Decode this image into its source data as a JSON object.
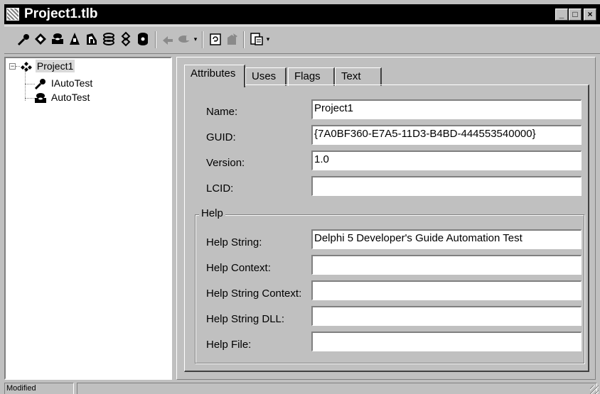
{
  "window": {
    "title": "Project1.tlb",
    "controls": {
      "minimize": "_",
      "maximize": "□",
      "close": "×"
    }
  },
  "toolbar": {
    "buttons": [
      "new-interface-icon",
      "new-dispinterface-icon",
      "new-coclass-icon",
      "new-enum-icon",
      "new-alias-icon",
      "new-record-icon",
      "new-union-icon",
      "new-module-icon",
      "new-method-icon",
      "new-property-icon",
      "refresh-icon",
      "register-icon",
      "export-icon"
    ],
    "dropdown_arrow": "▾"
  },
  "tree": {
    "root": {
      "label": "Project1",
      "expander": "−"
    },
    "children": [
      {
        "label": "IAutoTest",
        "icon": "interface-icon"
      },
      {
        "label": "AutoTest",
        "icon": "coclass-icon"
      }
    ]
  },
  "tabs": [
    "Attributes",
    "Uses",
    "Flags",
    "Text"
  ],
  "attributes": {
    "name_label": "Name:",
    "name_value": "Project1",
    "guid_label": "GUID:",
    "guid_value": "{7A0BF360-E7A5-11D3-B4BD-444553540000}",
    "version_label": "Version:",
    "version_value": "1.0",
    "lcid_label": "LCID:",
    "lcid_value": ""
  },
  "help": {
    "group_title": "Help",
    "help_string_label": "Help String:",
    "help_string_value": "Delphi 5 Developer's Guide Automation Test",
    "help_context_label": "Help Context:",
    "help_context_value": "",
    "help_string_context_label": "Help String Context:",
    "help_string_context_value": "",
    "help_string_dll_label": "Help String DLL:",
    "help_string_dll_value": "",
    "help_file_label": "Help File:",
    "help_file_value": ""
  },
  "status": {
    "text": "Modified"
  },
  "colors": {
    "face": "#c0c0c0",
    "titlebar": "#000000",
    "selection": "#d9d9d9"
  }
}
